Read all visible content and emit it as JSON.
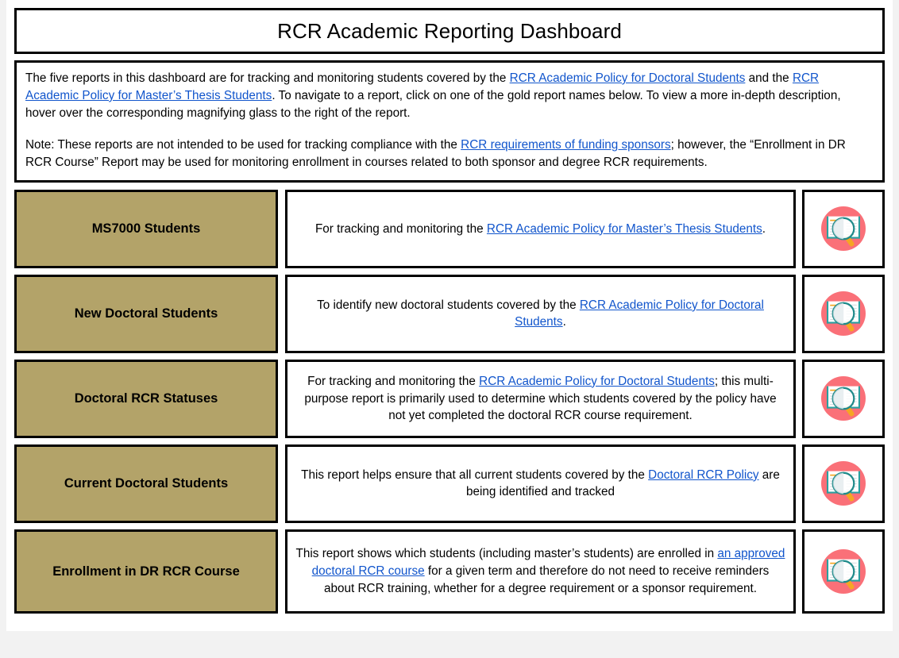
{
  "page": {
    "background_color": "#f2f2f2",
    "content_background_color": "#ffffff"
  },
  "header": {
    "title": "RCR Academic Reporting Dashboard"
  },
  "intro": {
    "paragraph1": {
      "part1": "The five reports in this dashboard are for tracking and monitoring students covered by the ",
      "link1": "RCR Academic Policy for Doctoral Students",
      "part2": " and the ",
      "link2": "RCR Academic Policy for Master’s Thesis Students",
      "part3": ".  To navigate to a report, click on one of the gold report names below. To view a more in-depth description, hover over the corresponding magnifying glass to the right of the report."
    },
    "paragraph2": {
      "part1": "Note:  These reports are not intended to be used for tracking compliance with the ",
      "link1": "RCR requirements of funding sponsors",
      "part2": "; however, the “Enrollment in DR RCR Course” Report may be used for monitoring enrollment in courses related to both sponsor and degree RCR requirements."
    }
  },
  "colors": {
    "gold_button": "#b3a369",
    "link": "#1155cc",
    "border": "#000000",
    "icon_circle": "#fa7078",
    "icon_teal": "#2aa0a0",
    "icon_orange": "#f5a623"
  },
  "reports": [
    {
      "name": "MS7000 Students",
      "description": {
        "part1": "For tracking and monitoring the ",
        "link1": "RCR Academic Policy for Master’s Thesis Students",
        "part2": "."
      },
      "icon": "magnifying-glass-book-icon"
    },
    {
      "name": "New Doctoral Students",
      "description": {
        "part1": "To identify new doctoral students covered by the ",
        "link1": "RCR Academic Policy for Doctoral Students",
        "part2": "."
      },
      "icon": "magnifying-glass-book-icon"
    },
    {
      "name": "Doctoral RCR Statuses",
      "description": {
        "part1": "For tracking and monitoring the ",
        "link1": "RCR Academic Policy for Doctoral Students",
        "part2": "; this multi-purpose report is primarily used to determine which students covered by the policy have not yet completed the doctoral RCR course requirement."
      },
      "icon": "magnifying-glass-book-icon"
    },
    {
      "name": "Current Doctoral Students",
      "description": {
        "part1": "This report helps ensure that all current students covered by the ",
        "link1": "Doctoral RCR Policy",
        "part2": " are being identified and tracked"
      },
      "icon": "magnifying-glass-book-icon"
    },
    {
      "name": "Enrollment in DR RCR Course",
      "description": {
        "part1": "This report shows which students (including master’s students) are enrolled in ",
        "link1": "an approved doctoral RCR course",
        "part2": " for a given term and therefore do not need to receive reminders about RCR training, whether for a degree requirement or a sponsor requirement."
      },
      "icon": "magnifying-glass-book-icon"
    }
  ]
}
